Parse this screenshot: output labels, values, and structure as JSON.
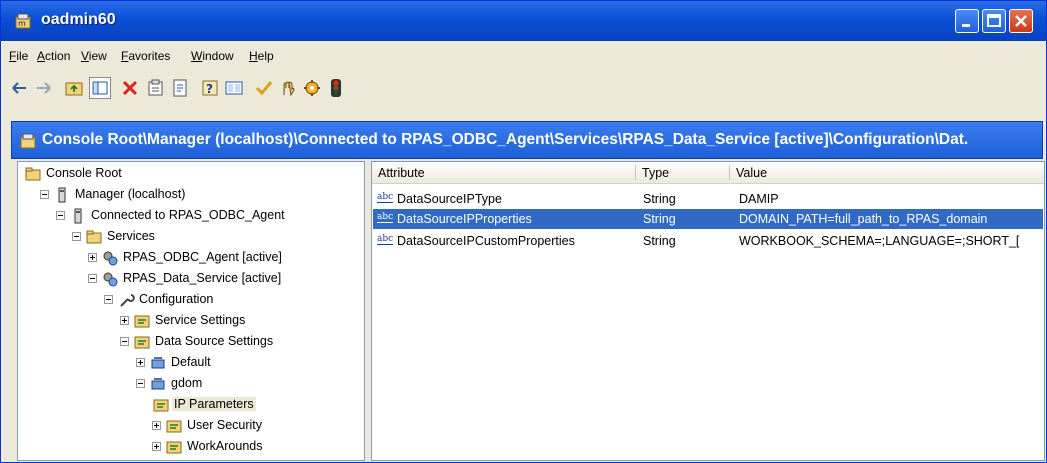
{
  "window": {
    "title": "oadmin60"
  },
  "menu": [
    "File",
    "Action",
    "View",
    "Favorites",
    "Window",
    "Help"
  ],
  "toolbar": {
    "buttons": [
      "back-arrow-icon",
      "forward-arrow-icon",
      "up-folder-icon",
      "show-hide-tree-icon",
      "delete-icon",
      "properties-icon",
      "export-list-icon",
      "help-icon",
      "view-icon",
      "check-icon",
      "hand-icon",
      "gear-icon",
      "traffic-light-icon"
    ]
  },
  "path": "Console Root\\Manager (localhost)\\Connected to RPAS_ODBC_Agent\\Services\\RPAS_Data_Service [active]\\Configuration\\Dat.",
  "tree": [
    {
      "label": "Console Root",
      "level": 0,
      "icon": "folder-icon",
      "expander": "none"
    },
    {
      "label": "Manager (localhost)",
      "level": 1,
      "icon": "server-icon",
      "expander": "minus"
    },
    {
      "label": "Connected to RPAS_ODBC_Agent",
      "level": 2,
      "icon": "server-icon",
      "expander": "minus"
    },
    {
      "label": "Services",
      "level": 3,
      "icon": "folder-icon",
      "expander": "minus"
    },
    {
      "label": "RPAS_ODBC_Agent [active]",
      "level": 4,
      "icon": "service-icon",
      "expander": "plus"
    },
    {
      "label": "RPAS_Data_Service [active]",
      "level": 4,
      "icon": "service-icon",
      "expander": "minus"
    },
    {
      "label": "Configuration",
      "level": 5,
      "icon": "wrench-icon",
      "expander": "minus"
    },
    {
      "label": "Service Settings",
      "level": 6,
      "icon": "settings-icon",
      "expander": "plus"
    },
    {
      "label": "Data Source Settings",
      "level": 6,
      "icon": "settings-icon",
      "expander": "minus"
    },
    {
      "label": "Default",
      "level": 7,
      "icon": "datasource-icon",
      "expander": "plus"
    },
    {
      "label": "gdom",
      "level": 7,
      "icon": "datasource-icon",
      "expander": "minus"
    },
    {
      "label": "IP Parameters",
      "level": 8,
      "icon": "settings-icon",
      "expander": "none",
      "selected": true
    },
    {
      "label": "User Security",
      "level": 8,
      "icon": "settings-icon",
      "expander": "plus"
    },
    {
      "label": "WorkArounds",
      "level": 8,
      "icon": "settings-icon",
      "expander": "plus"
    }
  ],
  "list": {
    "columns": [
      "Attribute",
      "Type",
      "Value"
    ],
    "type_icon": "abc",
    "rows": [
      {
        "attribute": "DataSourceIPType",
        "type": "String",
        "value": "DAMIP"
      },
      {
        "attribute": "DataSourceIPProperties",
        "type": "String",
        "value": "DOMAIN_PATH=full_path_to_RPAS_domain",
        "selected": true
      },
      {
        "attribute": "DataSourceIPCustomProperties",
        "type": "String",
        "value": "WORKBOOK_SCHEMA=;LANGUAGE=;SHORT_["
      }
    ]
  },
  "colors": {
    "titlebar": "#0A4FD4",
    "selection": "#316AC5",
    "close": "#C83A1C"
  }
}
